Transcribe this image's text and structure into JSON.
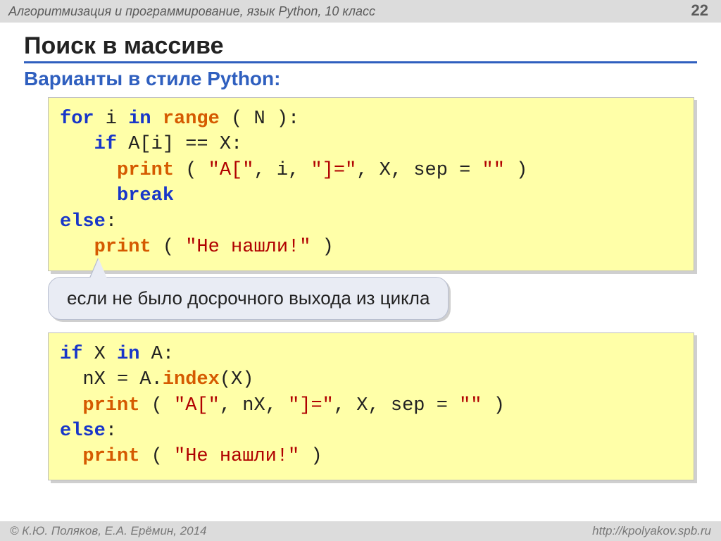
{
  "header": {
    "course": "Алгоритмизация и программирование, язык Python, 10 класс",
    "page": "22"
  },
  "title": "Поиск в массиве",
  "subtitle": "Варианты в стиле Python:",
  "code1": {
    "l1": {
      "kw1": "for",
      "t1": " i ",
      "kw2": "in",
      "t2": " ",
      "fn1": "range",
      "t3": " ( N ):"
    },
    "l2": {
      "t0": "   ",
      "kw1": "if",
      "t1": " A[i] == X:"
    },
    "l3": {
      "t0": "     ",
      "fn1": "print",
      "t1": " ( ",
      "s1": "\"A[\"",
      "t2": ", i, ",
      "s2": "\"]=\"",
      "t3": ", X, sep = ",
      "s3": "\"\"",
      "t4": " )"
    },
    "l4": {
      "t0": "     ",
      "kw1": "break"
    },
    "l5": {
      "kw1": "else",
      "t1": ":"
    },
    "l6": {
      "t0": "   ",
      "fn1": "print",
      "t1": " ( ",
      "s1": "\"Не нашли!\"",
      "t2": " )"
    }
  },
  "callout": "если не было досрочного выхода из цикла",
  "code2": {
    "l1": {
      "kw1": "if",
      "t1": " X ",
      "kw2": "in",
      "t2": " A:"
    },
    "l2": {
      "t0": "  nX = A.",
      "fn1": "index",
      "t1": "(X)"
    },
    "l3": {
      "t0": "  ",
      "fn1": "print",
      "t1": " ( ",
      "s1": "\"A[\"",
      "t2": ", nX, ",
      "s2": "\"]=\"",
      "t3": ", X, sep = ",
      "s3": "\"\"",
      "t4": " )"
    },
    "l4": {
      "kw1": "else",
      "t1": ":"
    },
    "l5": {
      "t0": "  ",
      "fn1": "print",
      "t1": " ( ",
      "s1": "\"Не нашли!\"",
      "t2": " )"
    }
  },
  "footer": {
    "left": "© К.Ю. Поляков, Е.А. Ерёмин, 2014",
    "right": "http://kpolyakov.spb.ru"
  }
}
